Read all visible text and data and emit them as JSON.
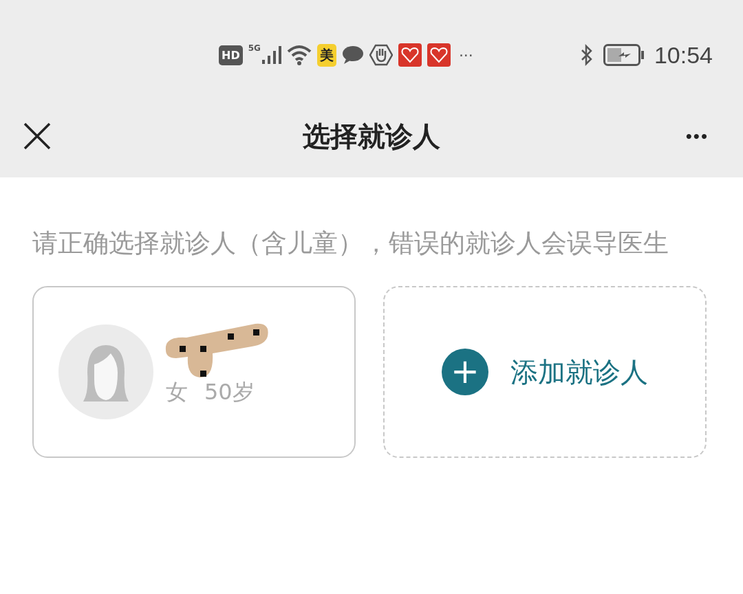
{
  "status_bar": {
    "badges": [
      "HD",
      "5G",
      "美"
    ],
    "more": "···",
    "time": "10:54"
  },
  "nav": {
    "title": "选择就诊人",
    "menu": "•••"
  },
  "hint": "请正确选择就诊人（含儿童），错误的就诊人会误导医生",
  "patients": [
    {
      "gender": "女",
      "age": "50岁",
      "name_redacted": true
    }
  ],
  "add_button": {
    "icon": "+",
    "label": "添加就诊人"
  }
}
